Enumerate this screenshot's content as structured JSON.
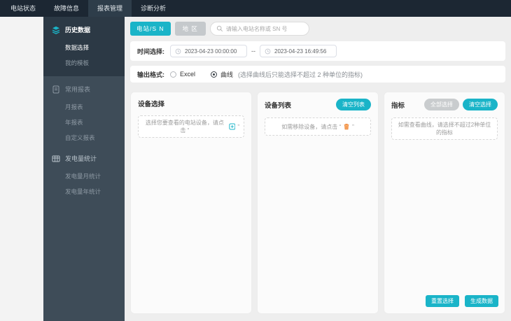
{
  "navbar": {
    "items": [
      {
        "label": "电站状态",
        "active": false
      },
      {
        "label": "故障信息",
        "active": false
      },
      {
        "label": "报表管理",
        "active": true
      },
      {
        "label": "诊断分析",
        "active": false
      }
    ]
  },
  "sidebar": {
    "sections": [
      {
        "label": "历史数据",
        "icon": "layers-icon",
        "children": [
          {
            "label": "数据选择",
            "active": true
          },
          {
            "label": "我的模板",
            "active": false
          }
        ]
      },
      {
        "label": "常用报表",
        "icon": "report-icon",
        "children": [
          {
            "label": "月报表"
          },
          {
            "label": "年报表"
          },
          {
            "label": "自定义报表"
          }
        ]
      },
      {
        "label": "发电量统计",
        "icon": "table-icon",
        "children": [
          {
            "label": "发电量月统计"
          },
          {
            "label": "发电量年统计"
          }
        ]
      }
    ]
  },
  "filters": {
    "station_sn_button": "电站/S N",
    "region_button": "地 区",
    "search_placeholder": "请输入电站名称或 SN 号",
    "time_label": "时间选择:",
    "time_start": "2023-04-23 00:00:00",
    "time_separator": "--",
    "time_end": "2023-04-23 16:49:56",
    "format_label": "输出格式:",
    "format_options": [
      {
        "label": "Excel",
        "selected": false,
        "note": ""
      },
      {
        "label": "曲线",
        "selected": true,
        "note": "(选择曲线后只能选择不超过 2 种单位的指标)"
      }
    ]
  },
  "panels": {
    "device_select": {
      "title": "设备选择",
      "placeholder_prefix": "选择您要查看的电站设备，请点击 “",
      "placeholder_suffix": "”",
      "placeholder_icon": "add-square-icon"
    },
    "device_list": {
      "title": "设备列表",
      "clear_button": "清空列表",
      "placeholder_prefix": "如需移除设备，请点击 “",
      "placeholder_suffix": "”",
      "placeholder_icon": "trash-icon"
    },
    "indicators": {
      "title": "指标",
      "select_all_button": "全部选择",
      "clear_button": "清空选择",
      "placeholder": "如需查看曲线，请选择不超过2种单位的指标"
    }
  },
  "actions": {
    "reset": "重置选择",
    "generate": "生成数据"
  },
  "colors": {
    "accent_teal": "#1ab4c8",
    "trash_orange": "#f08a3c",
    "navbar_bg": "#1c2733",
    "sidebar_bg": "#3e4c58",
    "sidebar_active_group_bg": "#2c3945"
  }
}
